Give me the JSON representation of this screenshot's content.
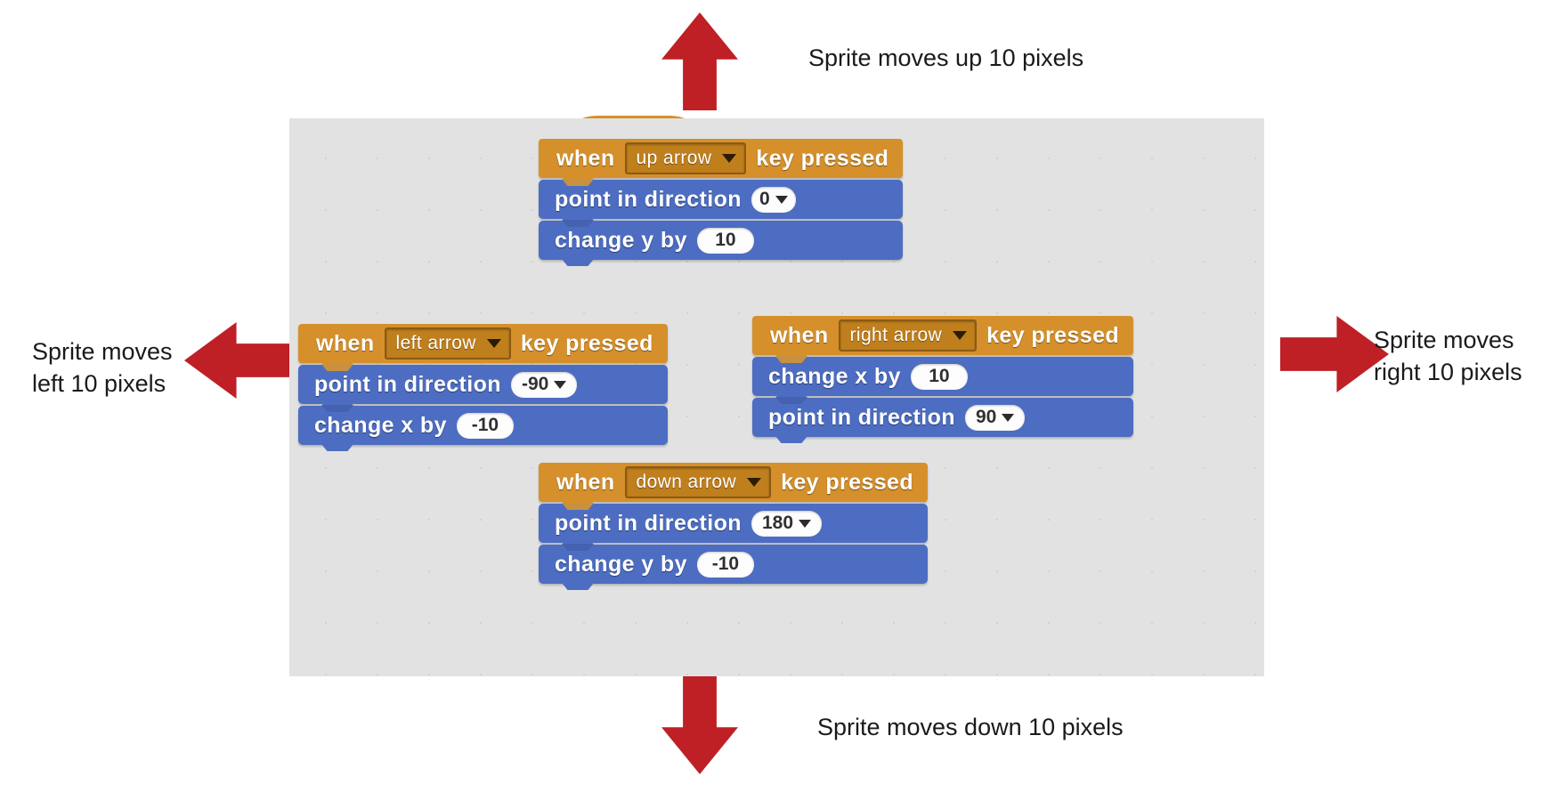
{
  "canvas": {
    "background_color": "#e2e2e2"
  },
  "colors": {
    "hat_block": "#d5902b",
    "motion_block": "#4d6dc2",
    "arrow": "#be2026",
    "value_slot": "#fdfdfd"
  },
  "annotations": {
    "up": "Sprite moves up 10 pixels",
    "down": "Sprite moves down 10 pixels",
    "left_line1": "Sprite moves",
    "left_line2": "left 10 pixels",
    "right_line1": "Sprite moves",
    "right_line2": "right 10 pixels"
  },
  "arrows": {
    "up": "arrow-up-icon",
    "down": "arrow-down-icon",
    "left": "arrow-left-icon",
    "right": "arrow-right-icon"
  },
  "scripts": {
    "up": {
      "hat": {
        "when": "when",
        "key": "up arrow",
        "suffix": "key  pressed"
      },
      "blocks": [
        {
          "label": "point  in  direction",
          "value": "0",
          "has_dropdown": true
        },
        {
          "label": "change  y  by",
          "value": "10",
          "has_dropdown": false
        }
      ]
    },
    "left": {
      "hat": {
        "when": "when",
        "key": "left arrow",
        "suffix": "key  pressed"
      },
      "blocks": [
        {
          "label": "point  in  direction",
          "value": "-90",
          "has_dropdown": true
        },
        {
          "label": "change  x  by",
          "value": "-10",
          "has_dropdown": false
        }
      ]
    },
    "right": {
      "hat": {
        "when": "when",
        "key": "right arrow",
        "suffix": "key  pressed"
      },
      "blocks": [
        {
          "label": "change  x  by",
          "value": "10",
          "has_dropdown": false
        },
        {
          "label": "point  in  direction",
          "value": "90",
          "has_dropdown": true
        }
      ]
    },
    "down": {
      "hat": {
        "when": "when",
        "key": "down arrow",
        "suffix": "key  pressed"
      },
      "blocks": [
        {
          "label": "point  in  direction",
          "value": "180",
          "has_dropdown": true
        },
        {
          "label": "change  y  by",
          "value": "-10",
          "has_dropdown": false
        }
      ]
    }
  }
}
